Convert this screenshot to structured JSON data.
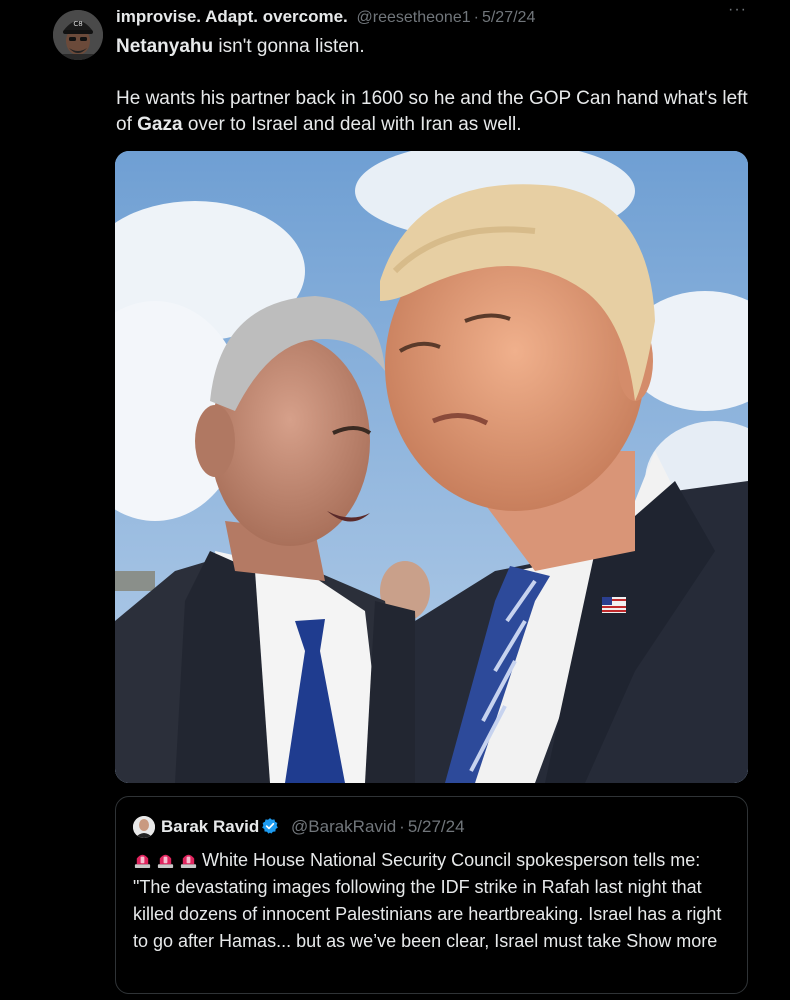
{
  "tweet": {
    "author": {
      "display_name": "improvise. Adapt. overcome.",
      "handle": "@reesetheone1",
      "separator": "·",
      "date": "5/27/24",
      "avatar_icon": "profile-avatar"
    },
    "more_icon": "more-icon",
    "more_glyph": "···",
    "text": {
      "line1_bold": "Netanyahu",
      "line1_rest": " isn't gonna listen.",
      "line2_part1": "He wants his partner back in 1600 so he and the GOP Can   hand what's left of ",
      "line2_bold": "Gaza",
      "line2_part2": " over to Israel and deal with Iran as well."
    },
    "media": {
      "description_icon": "photo-two-men-in-suits"
    }
  },
  "quote": {
    "author": {
      "display_name": "Barak Ravid",
      "verified_icon": "verified-badge-icon",
      "handle": "@BarakRavid",
      "separator": "·",
      "date": "5/27/24"
    },
    "emoji_icons": [
      "siren-icon",
      "siren-icon",
      "siren-icon"
    ],
    "text": "White House National Security Council spokesperson tells me: \"The devastating images following the IDF strike in Rafah last night that killed dozens of innocent Palestinians are heartbreaking. Israel has a right to go after Hamas... but as we’ve been clear, Israel must take",
    "show_more": "Show more"
  },
  "colors": {
    "background": "#000000",
    "text_primary": "#e7e9ea",
    "text_secondary": "#71767b",
    "border": "#2f3336",
    "verified": "#1d9bf0",
    "siren": "#e0245e"
  }
}
